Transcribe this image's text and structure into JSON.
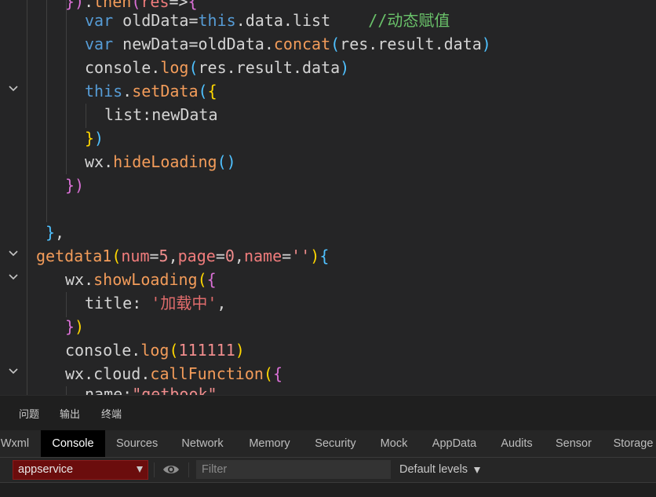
{
  "editor": {
    "lines": [
      {
        "tokens": [
          {
            "c": "t-br2",
            "t": "})"
          },
          {
            "c": "t-punc",
            "t": "."
          },
          {
            "c": "t-fn",
            "t": "then"
          },
          {
            "c": "t-br2",
            "t": "("
          },
          {
            "c": "t-param",
            "t": "res"
          },
          {
            "c": "t-punc",
            "t": "=>"
          },
          {
            "c": "t-br2",
            "t": "{"
          }
        ]
      },
      {
        "tokens": [
          {
            "c": "t-kw",
            "t": "var "
          },
          {
            "c": "t-var",
            "t": "oldData"
          },
          {
            "c": "t-punc",
            "t": "="
          },
          {
            "c": "t-this",
            "t": "this"
          },
          {
            "c": "t-punc",
            "t": "."
          },
          {
            "c": "t-prop",
            "t": "data"
          },
          {
            "c": "t-punc",
            "t": "."
          },
          {
            "c": "t-prop",
            "t": "list"
          },
          {
            "c": "t-punc",
            "t": "    "
          },
          {
            "c": "t-cmt",
            "t": "//动态赋值"
          }
        ]
      },
      {
        "tokens": [
          {
            "c": "t-kw",
            "t": "var "
          },
          {
            "c": "t-var",
            "t": "newData"
          },
          {
            "c": "t-punc",
            "t": "="
          },
          {
            "c": "t-var",
            "t": "oldData"
          },
          {
            "c": "t-punc",
            "t": "."
          },
          {
            "c": "t-fn",
            "t": "concat"
          },
          {
            "c": "t-br3",
            "t": "("
          },
          {
            "c": "t-var",
            "t": "res"
          },
          {
            "c": "t-punc",
            "t": "."
          },
          {
            "c": "t-prop",
            "t": "result"
          },
          {
            "c": "t-punc",
            "t": "."
          },
          {
            "c": "t-prop",
            "t": "data"
          },
          {
            "c": "t-br3",
            "t": ")"
          }
        ]
      },
      {
        "tokens": [
          {
            "c": "t-obj",
            "t": "console"
          },
          {
            "c": "t-punc",
            "t": "."
          },
          {
            "c": "t-fn",
            "t": "log"
          },
          {
            "c": "t-br3",
            "t": "("
          },
          {
            "c": "t-var",
            "t": "res"
          },
          {
            "c": "t-punc",
            "t": "."
          },
          {
            "c": "t-prop",
            "t": "result"
          },
          {
            "c": "t-punc",
            "t": "."
          },
          {
            "c": "t-prop",
            "t": "data"
          },
          {
            "c": "t-br3",
            "t": ")"
          }
        ]
      },
      {
        "tokens": [
          {
            "c": "t-this",
            "t": "this"
          },
          {
            "c": "t-punc",
            "t": "."
          },
          {
            "c": "t-fn",
            "t": "setData"
          },
          {
            "c": "t-br3",
            "t": "("
          },
          {
            "c": "t-br1",
            "t": "{"
          }
        ]
      },
      {
        "tokens": [
          {
            "c": "t-prop",
            "t": "list"
          },
          {
            "c": "t-punc",
            "t": ":"
          },
          {
            "c": "t-var",
            "t": "newData"
          }
        ]
      },
      {
        "tokens": [
          {
            "c": "t-br1",
            "t": "}"
          },
          {
            "c": "t-br3",
            "t": ")"
          }
        ]
      },
      {
        "tokens": [
          {
            "c": "t-obj",
            "t": "wx"
          },
          {
            "c": "t-punc",
            "t": "."
          },
          {
            "c": "t-fn",
            "t": "hideLoading"
          },
          {
            "c": "t-br3",
            "t": "()"
          }
        ]
      },
      {
        "tokens": [
          {
            "c": "t-br2",
            "t": "})"
          }
        ]
      },
      {
        "tokens": []
      },
      {
        "tokens": [
          {
            "c": "t-br3",
            "t": "}"
          },
          {
            "c": "t-punc",
            "t": ","
          }
        ]
      },
      {
        "tokens": [
          {
            "c": "t-fn",
            "t": "getdata1"
          },
          {
            "c": "t-br1",
            "t": "("
          },
          {
            "c": "t-param",
            "t": "num"
          },
          {
            "c": "t-punc",
            "t": "="
          },
          {
            "c": "t-num",
            "t": "5"
          },
          {
            "c": "t-punc",
            "t": ","
          },
          {
            "c": "t-param",
            "t": "page"
          },
          {
            "c": "t-punc",
            "t": "="
          },
          {
            "c": "t-num",
            "t": "0"
          },
          {
            "c": "t-punc",
            "t": ","
          },
          {
            "c": "t-param",
            "t": "name"
          },
          {
            "c": "t-punc",
            "t": "="
          },
          {
            "c": "t-str",
            "t": "''"
          },
          {
            "c": "t-br1",
            "t": ")"
          },
          {
            "c": "t-br3",
            "t": "{"
          }
        ]
      },
      {
        "tokens": [
          {
            "c": "t-obj",
            "t": "wx"
          },
          {
            "c": "t-punc",
            "t": "."
          },
          {
            "c": "t-fn",
            "t": "showLoading"
          },
          {
            "c": "t-br1",
            "t": "("
          },
          {
            "c": "t-br2",
            "t": "{"
          }
        ]
      },
      {
        "tokens": [
          {
            "c": "t-prop",
            "t": "title"
          },
          {
            "c": "t-punc",
            "t": ": "
          },
          {
            "c": "t-strc",
            "t": "'加载中'"
          },
          {
            "c": "t-punc",
            "t": ","
          }
        ]
      },
      {
        "tokens": [
          {
            "c": "t-br2",
            "t": "}"
          },
          {
            "c": "t-br1",
            "t": ")"
          }
        ]
      },
      {
        "tokens": [
          {
            "c": "t-obj",
            "t": "console"
          },
          {
            "c": "t-punc",
            "t": "."
          },
          {
            "c": "t-fn",
            "t": "log"
          },
          {
            "c": "t-br1",
            "t": "("
          },
          {
            "c": "t-num",
            "t": "111111"
          },
          {
            "c": "t-br1",
            "t": ")"
          }
        ]
      },
      {
        "tokens": [
          {
            "c": "t-obj",
            "t": "wx"
          },
          {
            "c": "t-punc",
            "t": "."
          },
          {
            "c": "t-prop",
            "t": "cloud"
          },
          {
            "c": "t-punc",
            "t": "."
          },
          {
            "c": "t-fn",
            "t": "callFunction"
          },
          {
            "c": "t-br1",
            "t": "("
          },
          {
            "c": "t-br2",
            "t": "{"
          }
        ]
      },
      {
        "tokens": [
          {
            "c": "t-prop",
            "t": "name"
          },
          {
            "c": "t-punc",
            "t": ":"
          },
          {
            "c": "t-str",
            "t": "\"getbook\""
          }
        ]
      }
    ]
  },
  "panel_tabs": [
    "问题",
    "输出",
    "终端"
  ],
  "devtools": {
    "tabs": [
      "Wxml",
      "Console",
      "Sources",
      "Network",
      "Memory",
      "Security",
      "Mock",
      "AppData",
      "Audits",
      "Sensor",
      "Storage"
    ],
    "active_tab": "Console"
  },
  "console": {
    "context": "appservice",
    "filter_value": "",
    "filter_placeholder": "Filter",
    "levels_label": "Default levels"
  },
  "colors": {
    "editor_bg": "#252526",
    "active_tab_bg": "#000000",
    "context_bg": "#6b0d0d"
  }
}
